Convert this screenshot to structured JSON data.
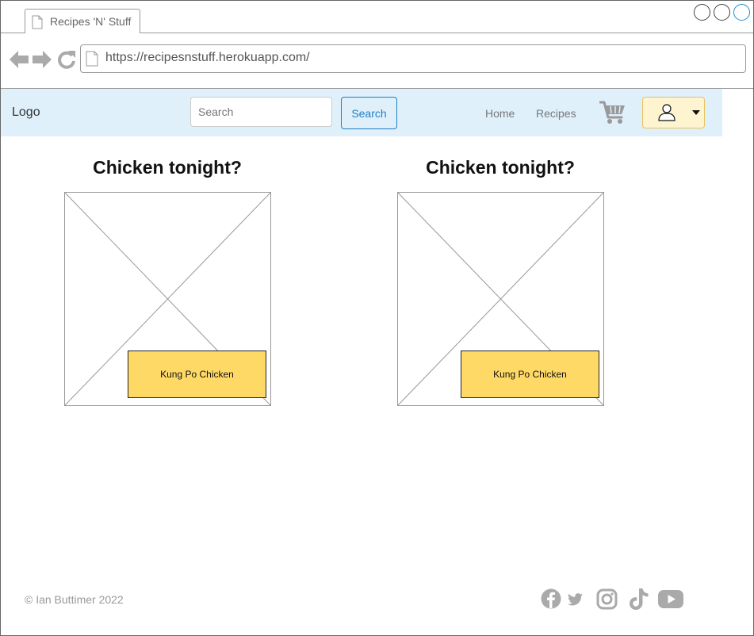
{
  "browser": {
    "tab_title": "Recipes 'N' Stuff",
    "url": "https://recipesnstuff.herokuapp.com/"
  },
  "navbar": {
    "logo": "Logo",
    "search_placeholder": "Search",
    "search_button": "Search",
    "links": [
      "Home",
      "Recipes"
    ]
  },
  "cards": [
    {
      "title": "Chicken tonight?",
      "label": "Kung Po Chicken"
    },
    {
      "title": "Chicken tonight?",
      "label": "Kung Po Chicken"
    }
  ],
  "footer": {
    "copyright": "© Ian Buttimer 2022",
    "social_icons": [
      "facebook-icon",
      "twitter-icon",
      "instagram-icon",
      "tiktok-icon",
      "youtube-icon"
    ]
  },
  "colors": {
    "navbar_bg": "#dff0fb",
    "search_button": "#1e7fc3",
    "label_bg": "#ffd966",
    "user_button_bg": "#fff4d0",
    "icon_gray": "#999999"
  }
}
